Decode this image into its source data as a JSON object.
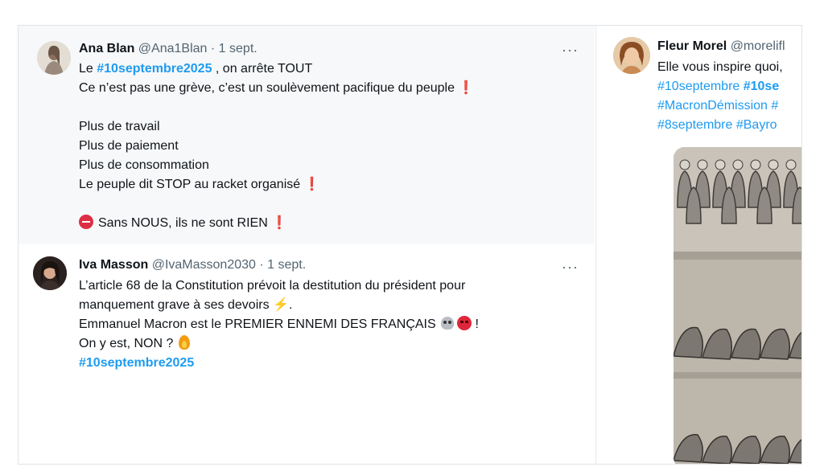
{
  "tweets": [
    {
      "name": "Ana Blan",
      "handle": "@Ana1Blan",
      "separator": "·",
      "date": "1 sept.",
      "more": "···",
      "text": {
        "l1_pre": "Le ",
        "l1_tag": "#10septembre2025",
        "l1_post": " , on arrête TOUT",
        "l2": " Ce n’est pas une grève, c’est un soulèvement pacifique du peuple ",
        "l2_mark": "❗",
        "l3": "Plus de travail",
        "l4": "Plus de paiement",
        "l5": "Plus de consommation",
        "l6": "Le peuple dit STOP au racket organisé ",
        "l6_mark": "❗",
        "l7": "Sans NOUS, ils ne sont RIEN ",
        "l7_mark": "❗"
      },
      "icons": [
        "stop-icon"
      ]
    },
    {
      "name": "Iva Masson",
      "handle": "@IvaMasson2030",
      "separator": "·",
      "date": "1 sept.",
      "more": "···",
      "text": {
        "l1": "L’article 68 de la Constitution prévoit la destitution du président pour",
        "l2": "manquement grave à ses devoirs ",
        "l2_emoji": "⚡",
        "l2_post": ".",
        "l3": "Emmanuel Macron est le PREMIER ENNEMI DES FRANÇAIS ",
        "l3_post": " !",
        "l4": "On y est, NON ? ",
        "l5_tag": "#10septembre2025"
      },
      "icons": [
        "skull-icon",
        "angry-face-icon",
        "fire-icon"
      ]
    },
    {
      "name": "Fleur Morel",
      "handle": "@morelifl",
      "text": {
        "l1": "Elle vous inspire quoi,",
        "l2_tag_a": "#10septembre ",
        "l2_tag_b": "#10se",
        "l3_tag_a": "#MacronDémission ",
        "l3_tag_b": "#",
        "l4_tag_a": "#8septembre ",
        "l4_tag_b": "#Bayro"
      },
      "media": "crowd-illustration"
    }
  ],
  "colors": {
    "hashtag": "#1d9bf0",
    "exclamation": "#e0245e",
    "secondary_text": "#536471"
  }
}
